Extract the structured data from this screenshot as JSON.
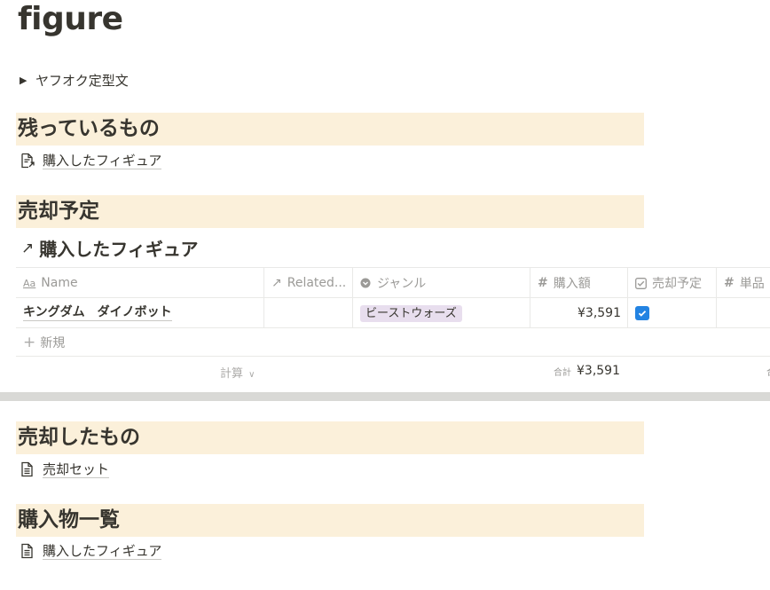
{
  "page": {
    "title": "figure",
    "toggle_label": "ヤフオク定型文"
  },
  "sections": {
    "remaining": {
      "heading": "残っているもの",
      "link": "購入したフィギュア"
    },
    "planned": {
      "heading": "売却予定",
      "db_title": "購入したフィギュア"
    },
    "sold": {
      "heading": "売却したもの",
      "link": "売却セット"
    },
    "purchases": {
      "heading": "購入物一覧",
      "link": "購入したフィギュア"
    }
  },
  "table": {
    "columns": {
      "name": "Name",
      "related": "Related...",
      "genre": "ジャンル",
      "price": "購入額",
      "sale_planned": "売却予定",
      "unit_price": "単品"
    },
    "rows": [
      {
        "name": "キングダム　ダイノボット",
        "genre": "ビーストウォーズ",
        "price": "¥3,591",
        "sale_planned": true
      }
    ],
    "new_label": "新規",
    "calc_label": "計算",
    "sum_prefix": "合計",
    "sum_value": "¥3,591",
    "sum_prefix_trailing": "合"
  },
  "colors": {
    "heading_background": "#fbf0da",
    "tag_background": "#e8deee",
    "checkbox": "#2383e2"
  }
}
